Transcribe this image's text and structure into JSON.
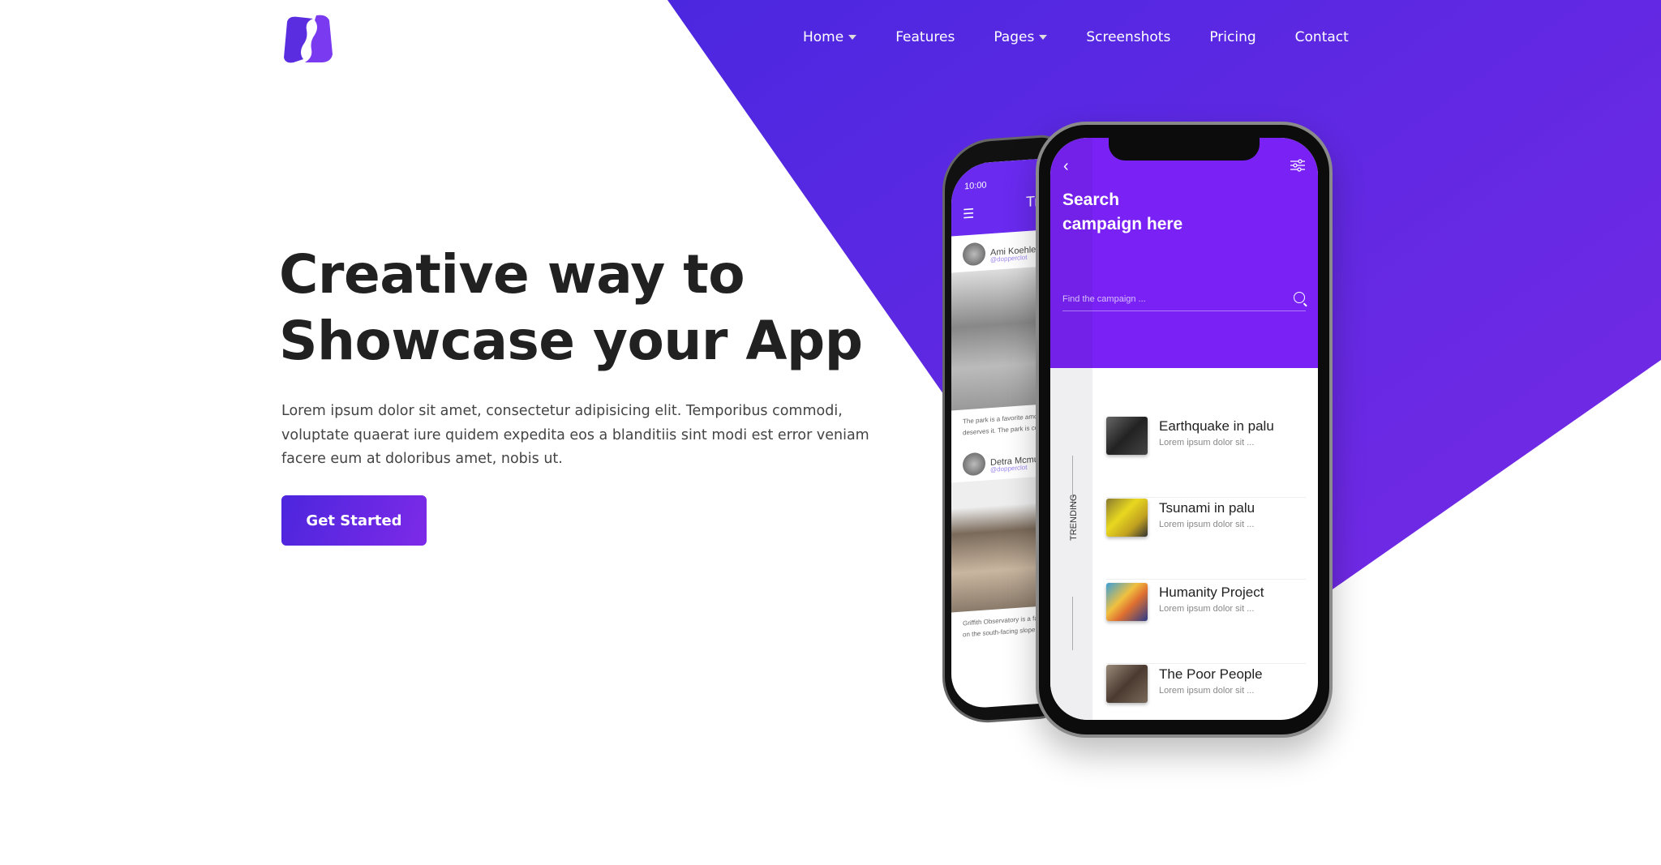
{
  "colors": {
    "accent": "#5b27e0",
    "accent_end": "#7d2ae8",
    "heading": "#212121",
    "text": "#444444"
  },
  "brand": {
    "logo_letter": "S"
  },
  "nav": {
    "items": [
      {
        "label": "Home",
        "dropdown": true
      },
      {
        "label": "Features"
      },
      {
        "label": "Pages",
        "dropdown": true
      },
      {
        "label": "Screenshots"
      },
      {
        "label": "Pricing"
      },
      {
        "label": "Contact"
      }
    ]
  },
  "hero": {
    "title_line1": "Creative way to",
    "title_line2": "Showcase your App",
    "description": "Lorem ipsum dolor sit amet, consectetur adipisicing elit. Temporibus commodi, voluptate quaerat iure quidem expedita eos a blanditiis sint modi est error veniam facere eum at doloribus amet, nobis ut.",
    "cta_label": "Get Started"
  },
  "phone_back": {
    "time": "10:00",
    "title_partial": "Tr",
    "posts": [
      {
        "name": "Ami Koehler",
        "handle": "@dopperclot",
        "caption1": "The park is a favorite among skat",
        "caption2": "deserves it. The park is complete"
      },
      {
        "name": "Detra Mcmunn",
        "handle": "@dopperclot",
        "caption1": "Griffith Observatory is a facility in",
        "caption2": "on the south-facing slope of Moun"
      }
    ]
  },
  "phone_front": {
    "title_line1": "Search",
    "title_line2": "campaign here",
    "search_placeholder": "Find the campaign ...",
    "side_label": "TRENDING",
    "items": [
      {
        "title": "Earthquake in palu",
        "subtitle": "Lorem ipsum dolor sit ...",
        "thumb": "linear-gradient(135deg,#666,#222 50%,#444)"
      },
      {
        "title": "Tsunami in palu",
        "subtitle": "Lorem ipsum dolor sit ...",
        "thumb": "linear-gradient(135deg,#8a7a30,#e8d820 40%,#c0a020 70%,#333)"
      },
      {
        "title": "Humanity Project",
        "subtitle": "Lorem ipsum dolor sit ...",
        "thumb": "linear-gradient(135deg,#3aa0d8,#f0c040 40%,#e07030 60%,#2a3a8a)"
      },
      {
        "title": "The Poor People",
        "subtitle": "Lorem ipsum dolor sit ...",
        "thumb": "linear-gradient(135deg,#9a8a7a,#4a3a30 50%,#7a6a5a)"
      }
    ]
  }
}
